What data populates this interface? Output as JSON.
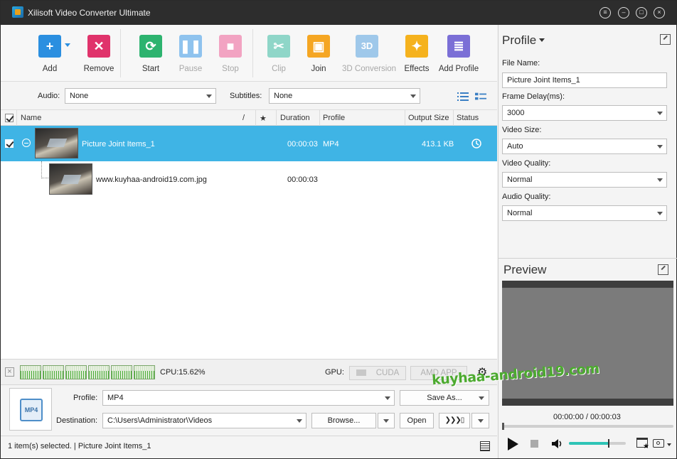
{
  "window": {
    "title": "Xilisoft Video Converter Ultimate"
  },
  "toolbar": {
    "buttons": [
      {
        "label": "Add",
        "icon": "add-icon",
        "color": "#2b8fe0",
        "enabled": true
      },
      {
        "label": "Remove",
        "icon": "remove-icon",
        "color": "#e0336b",
        "enabled": true
      },
      {
        "label": "Start",
        "icon": "start-icon",
        "color": "#2db36f",
        "enabled": true
      },
      {
        "label": "Pause",
        "icon": "pause-icon",
        "color": "#8fc3ee",
        "enabled": false
      },
      {
        "label": "Stop",
        "icon": "stop-icon",
        "color": "#f2a3c2",
        "enabled": false
      },
      {
        "label": "Clip",
        "icon": "clip-icon",
        "color": "#8fd6c8",
        "enabled": false
      },
      {
        "label": "Join",
        "icon": "join-icon",
        "color": "#f5a623",
        "enabled": true
      },
      {
        "label": "3D Conversion",
        "icon": "3d-icon",
        "color": "#9fc8ea",
        "enabled": false
      },
      {
        "label": "Effects",
        "icon": "effects-icon",
        "color": "#f5b21e",
        "enabled": true
      },
      {
        "label": "Add Profile",
        "icon": "add-profile-icon",
        "color": "#7b6fd6",
        "enabled": true
      }
    ]
  },
  "filters": {
    "audio_label": "Audio:",
    "audio_value": "None",
    "subtitles_label": "Subtitles:",
    "subtitles_value": "None"
  },
  "list": {
    "columns": {
      "name": "Name",
      "edit": "/",
      "star": "★",
      "duration": "Duration",
      "profile": "Profile",
      "output_size": "Output Size",
      "status": "Status"
    },
    "rows": [
      {
        "name": "Picture Joint Items_1",
        "duration": "00:00:03",
        "profile": "MP4",
        "output_size": "413.1 KB",
        "selected": true
      },
      {
        "name": "www.kuyhaa-android19.com.jpg",
        "duration": "00:00:03",
        "profile": "",
        "output_size": "",
        "selected": false
      }
    ]
  },
  "cpu": {
    "label": "CPU:15.62%",
    "gpu_label": "GPU:",
    "cuda": "CUDA",
    "amd": "AMD APP"
  },
  "output": {
    "profile_label": "Profile:",
    "profile_value": "MP4",
    "save_as": "Save As...",
    "destination_label": "Destination:",
    "destination_value": "C:\\Users\\Administrator\\Videos",
    "browse": "Browse...",
    "open": "Open"
  },
  "status": {
    "text": "1 item(s) selected. | Picture Joint Items_1"
  },
  "profile_panel": {
    "title": "Profile",
    "file_name_label": "File Name:",
    "file_name_value": "Picture Joint Items_1",
    "frame_delay_label": "Frame Delay(ms):",
    "frame_delay_value": "3000",
    "video_size_label": "Video Size:",
    "video_size_value": "Auto",
    "video_quality_label": "Video Quality:",
    "video_quality_value": "Normal",
    "audio_quality_label": "Audio Quality:",
    "audio_quality_value": "Normal"
  },
  "preview": {
    "title": "Preview",
    "time": "00:00:00 / 00:00:03",
    "volume_level": 0.7
  },
  "watermark": "kuyhaa-android19.com"
}
